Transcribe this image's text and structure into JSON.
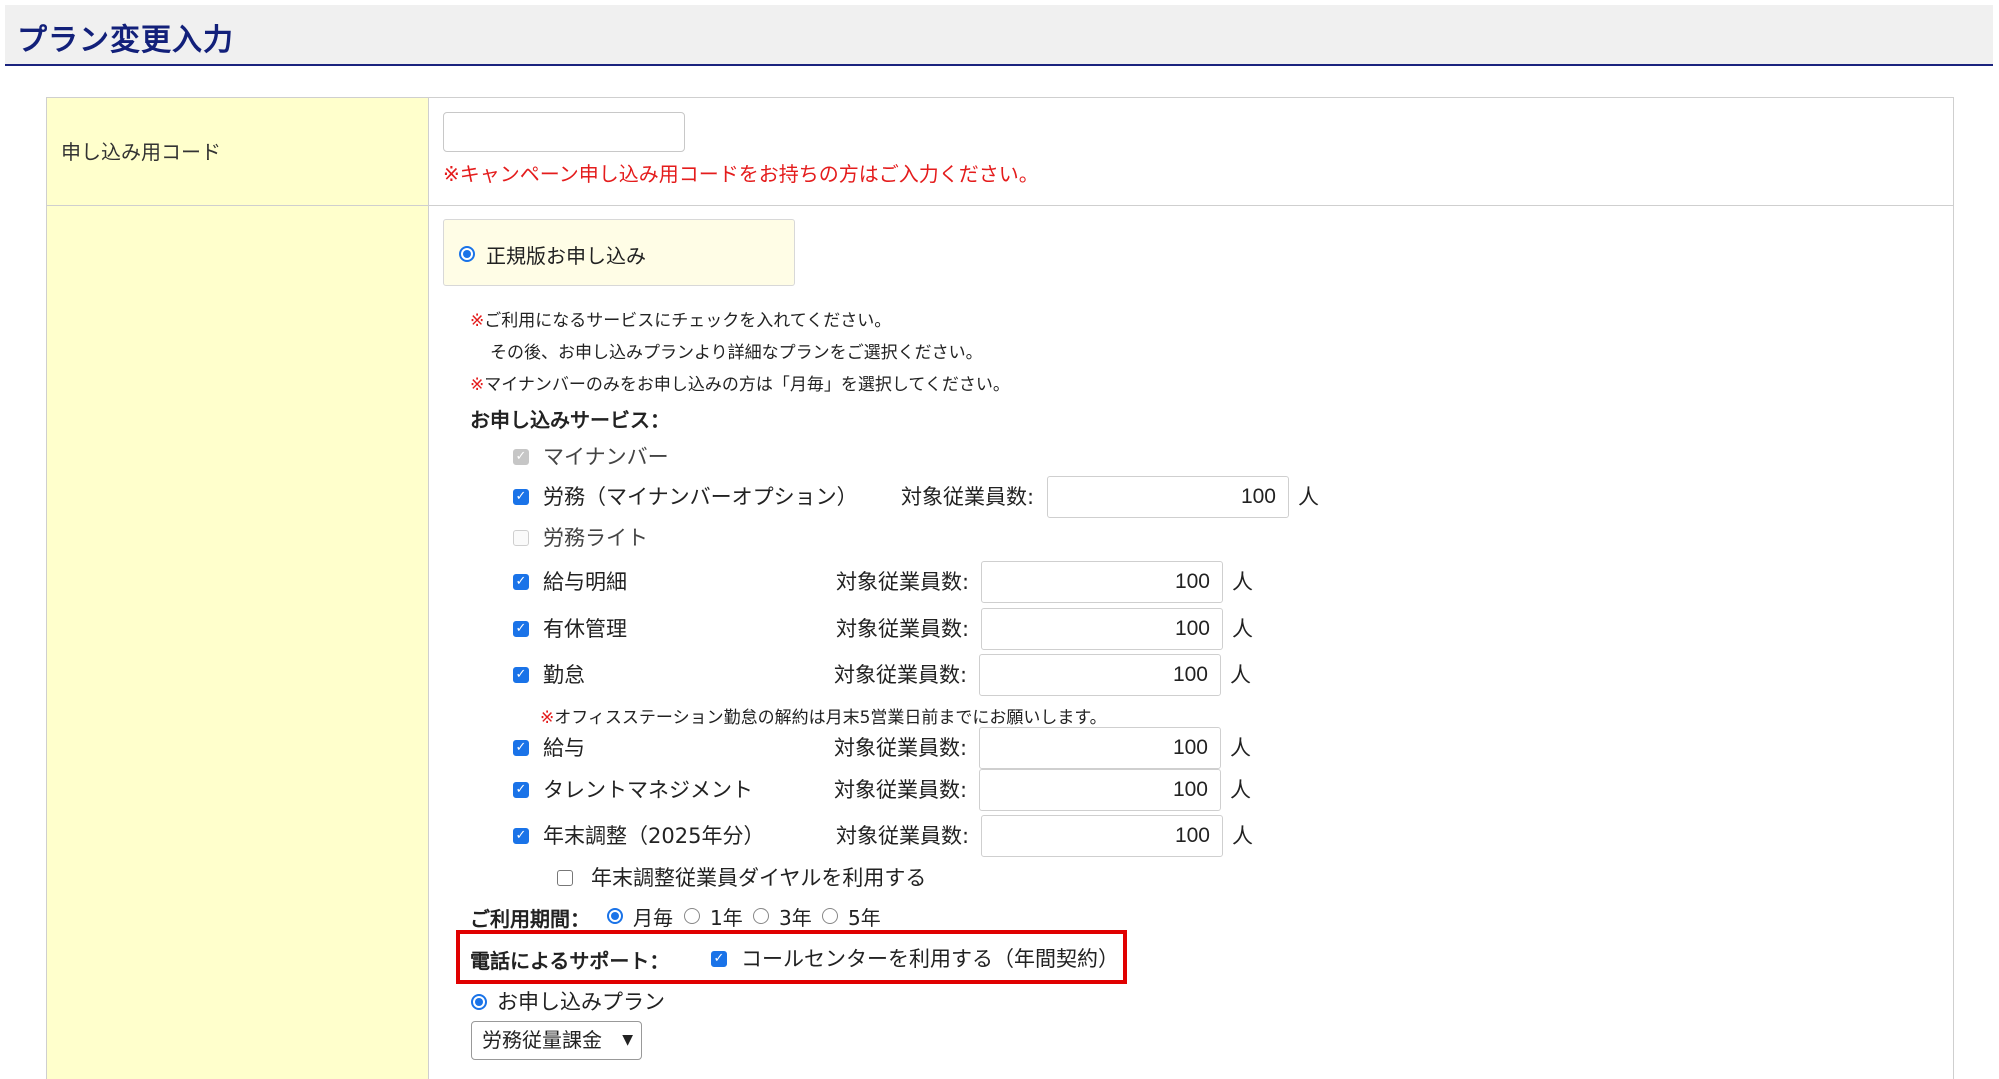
{
  "page": {
    "title": "プラン変更入力"
  },
  "code": {
    "label": "申し込み用コード",
    "value": "",
    "note": "※キャンペーン申し込み用コードをお持ちの方はご入力ください。"
  },
  "plan_option": {
    "label": "正規版お申し込み",
    "selected": true
  },
  "notes": {
    "mark": "※",
    "line1": "ご利用になるサービスにチェックを入れてください。",
    "line2": "その後、お申し込みプランより詳細なプランをご選択ください。",
    "line3": "マイナンバーのみをお申し込みの方は「月毎」を選択してください。"
  },
  "services": {
    "heading": "お申し込みサービス：",
    "emp_label": "対象従業員数:",
    "unit": "人",
    "items": [
      {
        "label": "マイナンバー",
        "checked": true,
        "disabled": true
      },
      {
        "label": "労務（マイナンバーオプション）",
        "checked": true,
        "count": "100"
      },
      {
        "label": "労務ライト",
        "checked": false,
        "disabled": true
      },
      {
        "label": "給与明細",
        "checked": true,
        "count": "100"
      },
      {
        "label": "有休管理",
        "checked": true,
        "count": "100"
      },
      {
        "label": "勤怠",
        "checked": true,
        "count": "100"
      },
      {
        "label": "給与",
        "checked": true,
        "count": "100"
      },
      {
        "label": "タレントマネジメント",
        "checked": true,
        "count": "100"
      },
      {
        "label": "年末調整（2025年分）",
        "checked": true,
        "count": "100"
      }
    ],
    "kintai_note": "オフィスステーション勤怠の解約は月末5営業日前までにお願いします。",
    "dial_option": {
      "label": "年末調整従業員ダイヤルを利用する",
      "checked": false
    }
  },
  "period": {
    "label": "ご利用期間：",
    "options": [
      "月毎",
      "1年",
      "3年",
      "5年"
    ],
    "selected": "月毎"
  },
  "support": {
    "label": "電話によるサポート：",
    "option": "コールセンターを利用する（年間契約）",
    "checked": true
  },
  "apply_plan": {
    "label": "お申し込みプラン",
    "selected": true,
    "select_value": "労務従量課金"
  },
  "colors": {
    "title": "#12207a",
    "label_bg": "#ffffcc",
    "note_red": "#e41c1c",
    "highlight": "#e00000",
    "accent": "#1a73e8"
  }
}
